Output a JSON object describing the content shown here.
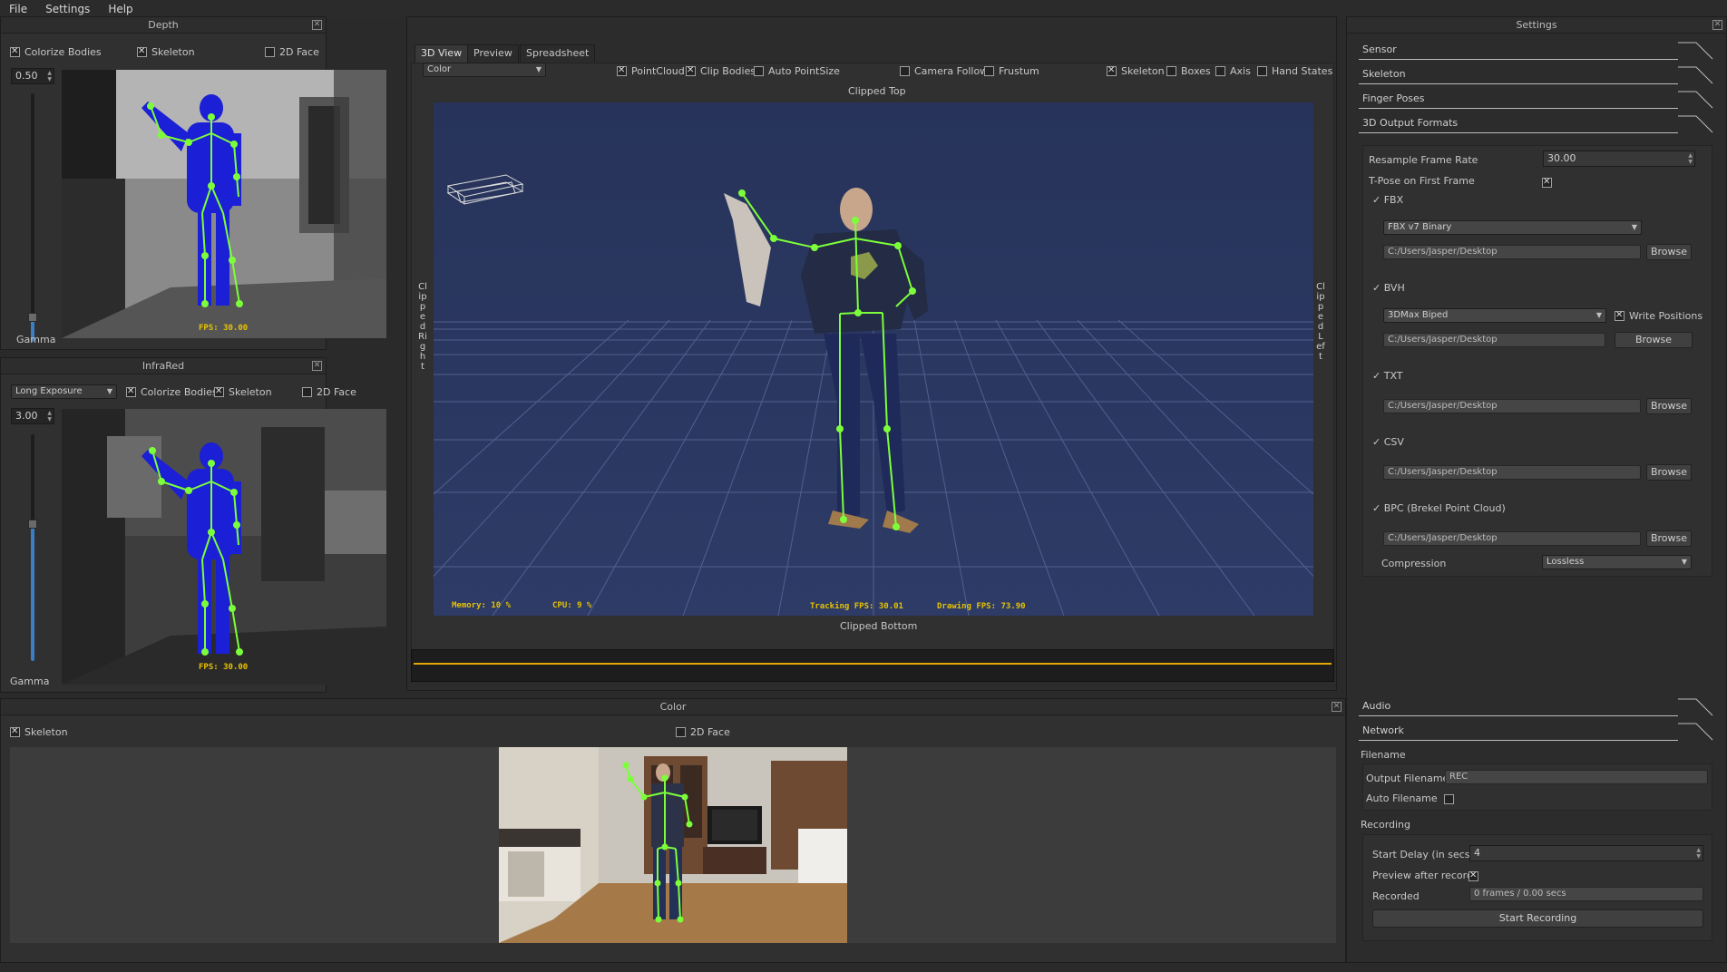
{
  "menu": [
    "File",
    "Settings",
    "Help"
  ],
  "depth": {
    "title": "Depth",
    "options": {
      "colorize": "Colorize Bodies",
      "skeleton": "Skeleton",
      "face2d": "2D Face"
    },
    "value": "0.50",
    "gamma": "Gamma",
    "fps": "FPS: 30.00"
  },
  "infrared": {
    "title": "InfraRed",
    "mode": "Long Exposure",
    "options": {
      "colorize": "Colorize Bodies",
      "skeleton": "Skeleton",
      "face2d": "2D Face"
    },
    "value": "3.00",
    "gamma": "Gamma",
    "fps": "FPS: 30.00"
  },
  "view3d": {
    "tabs": [
      "3D View",
      "Preview",
      "Spreadsheet"
    ],
    "color_mode": "Color",
    "toggles": {
      "pointcloud": "PointCloud",
      "clip": "Clip Bodies",
      "autopoint": "Auto PointSize",
      "camfollow": "Camera Follow",
      "frustum": "Frustum",
      "skeleton": "Skeleton",
      "boxes": "Boxes",
      "axis": "Axis",
      "hand": "Hand States"
    },
    "clipped_top": "Clipped Top",
    "clipped_bottom": "Clipped Bottom",
    "clipped_right": "Clipped Right",
    "clipped_left": "Clipped Left",
    "stats": {
      "memory": "Memory:  10 %",
      "cpu": "CPU:  9 %",
      "tracking": "Tracking FPS: 30.01",
      "drawing": "Drawing FPS: 73.90"
    }
  },
  "color": {
    "title": "Color",
    "skeleton": "Skeleton",
    "face2d": "2D Face"
  },
  "settings": {
    "title": "Settings",
    "sections": [
      "Sensor",
      "Skeleton",
      "Finger Poses",
      "3D Output Formats"
    ],
    "resample_label": "Resample Frame Rate",
    "resample_value": "30.00",
    "tpose_label": "T-Pose on First Frame",
    "fbx_label": "FBX",
    "fbx_format": "FBX v7 Binary",
    "path": "C:/Users/Jasper/Desktop",
    "browse": "Browse",
    "bvh_label": "BVH",
    "bvh_format": "3DMax Biped",
    "write_positions": "Write Positions",
    "txt_label": "TXT",
    "csv_label": "CSV",
    "bpc_label": "BPC (Brekel Point Cloud)",
    "compression_label": "Compression",
    "compression_value": "Lossless",
    "audio": "Audio",
    "network": "Network",
    "filename_hdr": "Filename",
    "output_filename_label": "Output Filename",
    "output_filename": "REC",
    "auto_filename": "Auto Filename",
    "recording_hdr": "Recording",
    "start_delay_label": "Start Delay (in secs)",
    "start_delay": "4",
    "preview_after": "Preview after record",
    "recorded_label": "Recorded",
    "recorded_value": "0 frames / 0.00 secs",
    "start_button": "Start Recording"
  },
  "colors": {
    "accent": "#3b7ec3",
    "skeleton": "#7cff3a",
    "fps": "#e6c200",
    "viewport": "#27335a"
  }
}
